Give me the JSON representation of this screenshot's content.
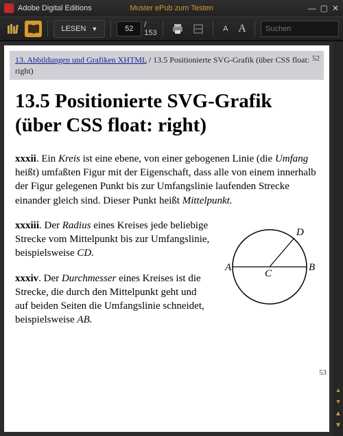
{
  "titlebar": {
    "app": "Adobe Digital Editions",
    "doc": "Muster ePub zum Testen"
  },
  "toolbar": {
    "mode_label": "LESEN",
    "page_current": "52",
    "page_total": "/ 153",
    "search_placeholder": "Suchen",
    "font_small": "A",
    "font_big": "A"
  },
  "breadcrumb": {
    "link": "13. Abbildungen und Grafiken XHTML",
    "sep": " / ",
    "current": "13.5 Positionierte SVG-Grafik (über CSS float: right)",
    "pagenum": "52"
  },
  "heading": "13.5 Positionierte SVG-Grafik (über CSS float: right)",
  "p1": {
    "num": "xxxii",
    "a": ". Ein ",
    "kreis": "Kreis",
    "b": " ist eine ebene, von einer gebogenen Linie (die ",
    "umfang": "Umfang",
    "c": " heißt) umfaßten Figur mit der Eigenschaft, dass alle von einem innerhalb der Figur gelegenen Punkt bis zur Umfangslinie laufenden Strecke einander gleich sind. Dieser Punkt heißt ",
    "mittel": "Mittelpunkt.",
    "d": ""
  },
  "p2": {
    "num": "xxxiii",
    "a": ". Der ",
    "radius": "Radius",
    "b": " eines Kreises jede beliebige Strecke vom Mittelpunkt bis zur Umfangslinie, beispielsweise ",
    "cd": "CD.",
    "c": ""
  },
  "p3": {
    "num": "xxxiv",
    "a": ". Der ",
    "durch": "Durchmesser",
    "b": " eines Kreises ist die Strecke, die durch den Mittelpunkt geht und auf beiden Seiten die Umfangslinie schneidet, beispielsweise ",
    "ab": "AB.",
    "c": ""
  },
  "fig": {
    "A": "A",
    "B": "B",
    "C": "C",
    "D": "D"
  },
  "pagenum2": "53"
}
